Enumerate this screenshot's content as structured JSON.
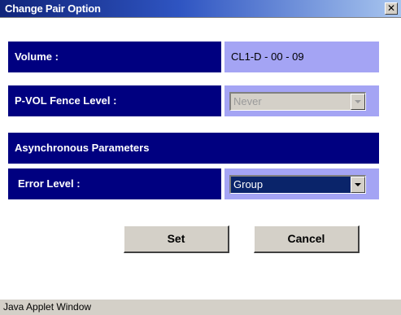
{
  "window": {
    "title": "Change Pair Option",
    "close_glyph": "✕"
  },
  "volume": {
    "label": "Volume :",
    "value": "CL1-D - 00 - 09"
  },
  "fence_level": {
    "label": "P-VOL Fence Level :",
    "selected": "Never",
    "enabled": false
  },
  "async_section": {
    "header": "Asynchronous Parameters"
  },
  "error_level": {
    "label": "Error Level :",
    "selected": "Group",
    "enabled": true
  },
  "buttons": {
    "set_label": "Set",
    "cancel_label": "Cancel"
  },
  "status_bar": {
    "text": "Java Applet Window"
  },
  "colors": {
    "label_bg": "#000080",
    "value_bg": "#a4a4f4",
    "face": "#d4d0c8",
    "selection": "#0a246a"
  },
  "icons": {
    "close": "close-icon",
    "dropdown": "chevron-down-icon"
  }
}
